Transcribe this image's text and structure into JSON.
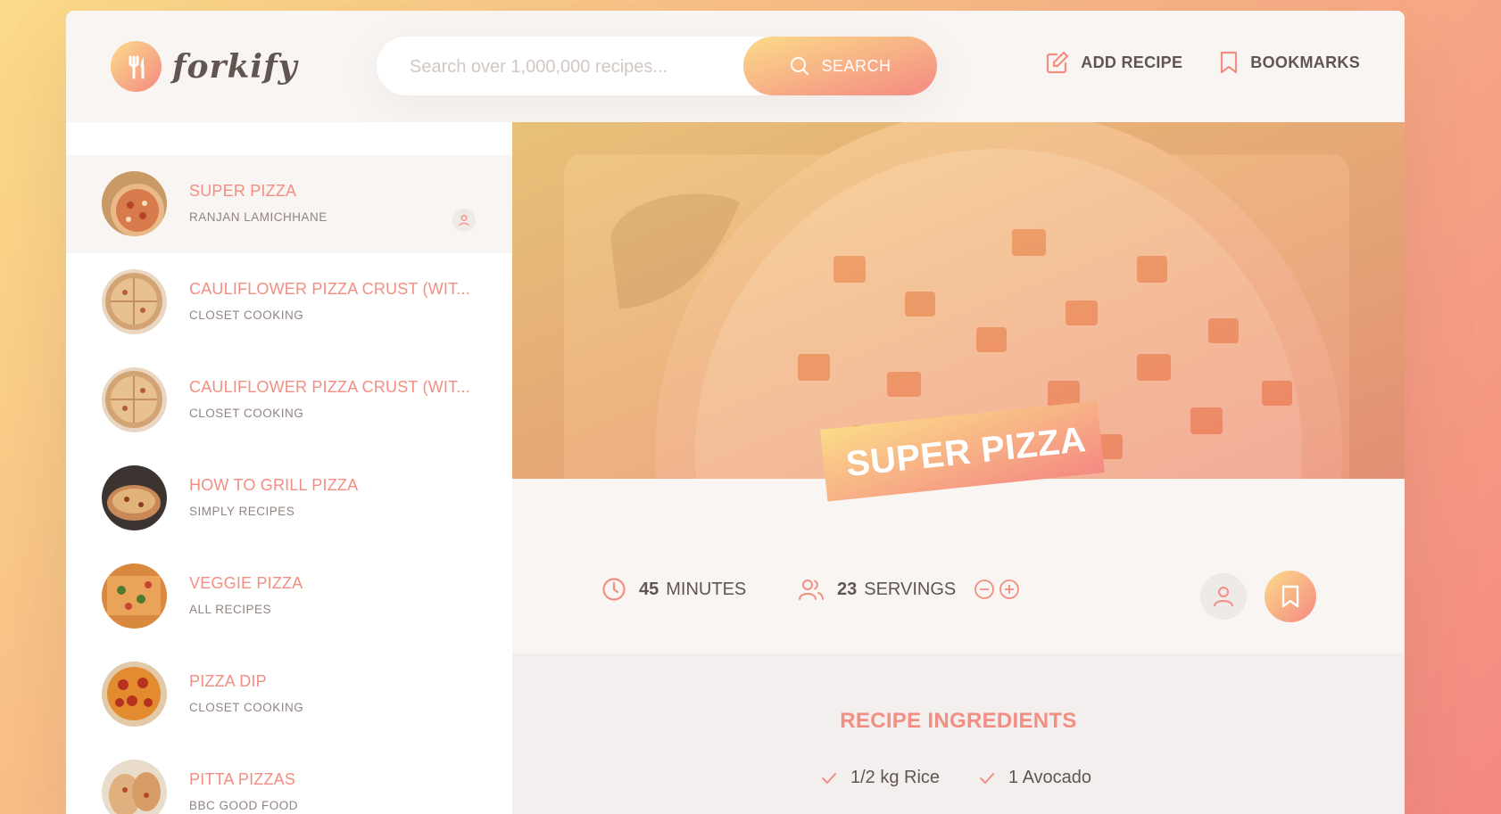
{
  "app": {
    "logo_text": "forkify"
  },
  "search": {
    "placeholder": "Search over 1,000,000 recipes...",
    "button_label": "SEARCH"
  },
  "nav": {
    "add_recipe": "ADD RECIPE",
    "bookmarks": "BOOKMARKS"
  },
  "results": [
    {
      "title": "SUPER PIZZA",
      "publisher": "RANJAN LAMICHHANE",
      "active": true,
      "user_generated": true
    },
    {
      "title": "CAULIFLOWER PIZZA CRUST (WIT...",
      "publisher": "CLOSET COOKING"
    },
    {
      "title": "CAULIFLOWER PIZZA CRUST (WIT...",
      "publisher": "CLOSET COOKING"
    },
    {
      "title": "HOW TO GRILL PIZZA",
      "publisher": "SIMPLY RECIPES"
    },
    {
      "title": "VEGGIE PIZZA",
      "publisher": "ALL RECIPES"
    },
    {
      "title": "PIZZA DIP",
      "publisher": "CLOSET COOKING"
    },
    {
      "title": "PITTA PIZZAS",
      "publisher": "BBC GOOD FOOD"
    }
  ],
  "recipe": {
    "title": "SUPER PIZZA",
    "minutes": "45",
    "minutes_label": "MINUTES",
    "servings": "23",
    "servings_label": "SERVINGS",
    "ingredients_heading": "RECIPE INGREDIENTS",
    "ingredients": [
      "1/2 kg Rice",
      "1 Avocado"
    ]
  },
  "colors": {
    "accent": "#f38e82",
    "text": "#615551",
    "gradient_start": "#fbdb89",
    "gradient_end": "#f48982"
  },
  "icons": [
    "fork-knife-icon",
    "search-icon",
    "edit-icon",
    "bookmark-icon",
    "user-icon",
    "clock-icon",
    "users-icon",
    "minus-circle-icon",
    "plus-circle-icon",
    "check-icon"
  ]
}
